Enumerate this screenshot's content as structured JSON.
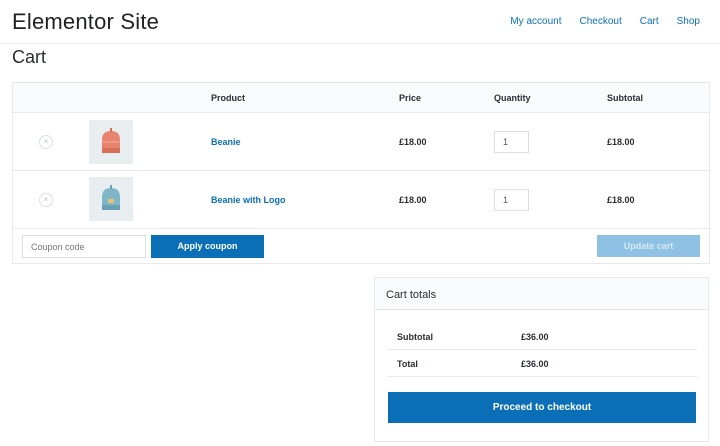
{
  "site": {
    "title": "Elementor Site"
  },
  "nav": {
    "items": [
      "My account",
      "Checkout",
      "Cart",
      "Shop"
    ]
  },
  "page": {
    "title": "Cart"
  },
  "cart": {
    "headers": {
      "product": "Product",
      "price": "Price",
      "quantity": "Quantity",
      "subtotal": "Subtotal"
    },
    "items": [
      {
        "name": "Beanie",
        "price": "£18.00",
        "quantity": "1",
        "subtotal": "£18.00",
        "thumb_color": "#e8846e",
        "remove_glyph": "×"
      },
      {
        "name": "Beanie with Logo",
        "price": "£18.00",
        "quantity": "1",
        "subtotal": "£18.00",
        "thumb_color": "#7fb6c8",
        "remove_glyph": "×"
      }
    ],
    "coupon_placeholder": "Coupon code",
    "apply_label": "Apply coupon",
    "update_label": "Update cart"
  },
  "totals": {
    "title": "Cart totals",
    "subtotal_label": "Subtotal",
    "subtotal_value": "£36.00",
    "total_label": "Total",
    "total_value": "£36.00",
    "checkout_label": "Proceed to checkout"
  },
  "colors": {
    "accent": "#0b6fb8",
    "disabled_button": "#8ec1e4",
    "border": "#e6e8ea"
  }
}
